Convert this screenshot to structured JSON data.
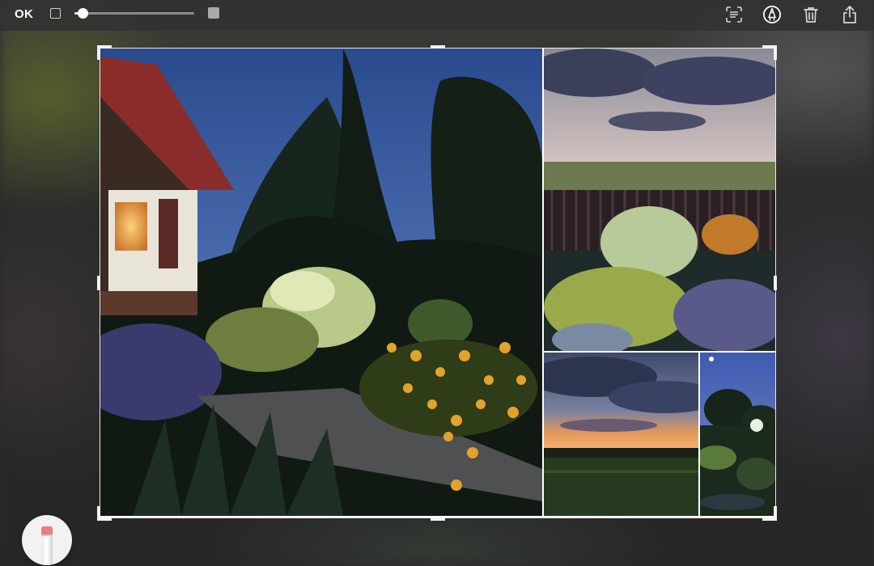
{
  "toolbar": {
    "ok_label": "OK",
    "size_slider_value": 0.04,
    "icons": {
      "left_small": "small-square-icon",
      "left_large": "large-square-icon",
      "scan_text": "live-text-scan-icon",
      "markup": "markup-pen-icon",
      "delete": "trash-icon",
      "share": "share-icon"
    }
  },
  "canvas": {
    "content": "photo-collage",
    "tiles": [
      "garden-house-evening",
      "garden-fence-clouds",
      "sunset-field",
      "garden-moon"
    ]
  },
  "tool": {
    "icon": "eraser-tool-icon"
  },
  "colors": {
    "toolbar_bg": "#323232",
    "accent_white": "#ffffff"
  }
}
